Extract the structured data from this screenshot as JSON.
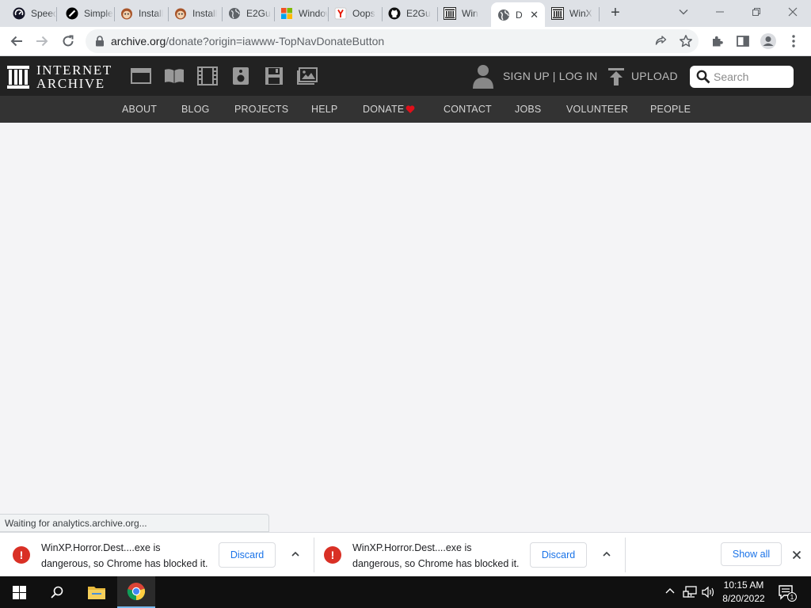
{
  "browser": {
    "tabs": [
      {
        "label": "Speedtest",
        "icon": "speedtest-icon",
        "active": false
      },
      {
        "label": "Simple",
        "icon": "simple-icon",
        "active": false
      },
      {
        "label": "Install",
        "icon": "monkey-icon",
        "active": false
      },
      {
        "label": "Install",
        "icon": "monkey-icon",
        "active": false
      },
      {
        "label": "E2Gu",
        "icon": "globe-icon",
        "active": false
      },
      {
        "label": "Windows",
        "icon": "windows-logo-icon",
        "active": false
      },
      {
        "label": "Oops",
        "icon": "yandex-icon",
        "active": false
      },
      {
        "label": "E2Gu",
        "icon": "github-icon",
        "active": false
      },
      {
        "label": "Win",
        "icon": "archive-icon",
        "active": false
      },
      {
        "label": "D",
        "icon": "globe-icon",
        "active": true
      },
      {
        "label": "WinX",
        "icon": "archive-icon",
        "active": false
      }
    ],
    "url_host": "archive.org",
    "url_path": "/donate?origin=iawww-TopNavDonateButton",
    "status_text": "Waiting for analytics.archive.org..."
  },
  "ia": {
    "logo_line1": "INTERNET",
    "logo_line2": "ARCHIVE",
    "media_icons": [
      "web-icon",
      "texts-icon",
      "video-icon",
      "audio-icon",
      "software-icon",
      "images-icon"
    ],
    "signup": "SIGN UP | LOG IN",
    "upload": "UPLOAD",
    "search_placeholder": "Search",
    "nav": [
      "ABOUT",
      "BLOG",
      "PROJECTS",
      "HELP",
      "DONATE",
      "CONTACT",
      "JOBS",
      "VOLUNTEER",
      "PEOPLE"
    ],
    "heart_color": "#e0101a"
  },
  "downloads": {
    "items": [
      {
        "line1": "WinXP.Horror.Dest....exe is",
        "line2": "dangerous, so Chrome has blocked it.",
        "button": "Discard"
      },
      {
        "line1": "WinXP.Horror.Dest....exe is",
        "line2": "dangerous, so Chrome has blocked it.",
        "button": "Discard"
      }
    ],
    "show_all": "Show all"
  },
  "taskbar": {
    "time": "10:15 AM",
    "date": "8/20/2022",
    "notifications": "1"
  }
}
